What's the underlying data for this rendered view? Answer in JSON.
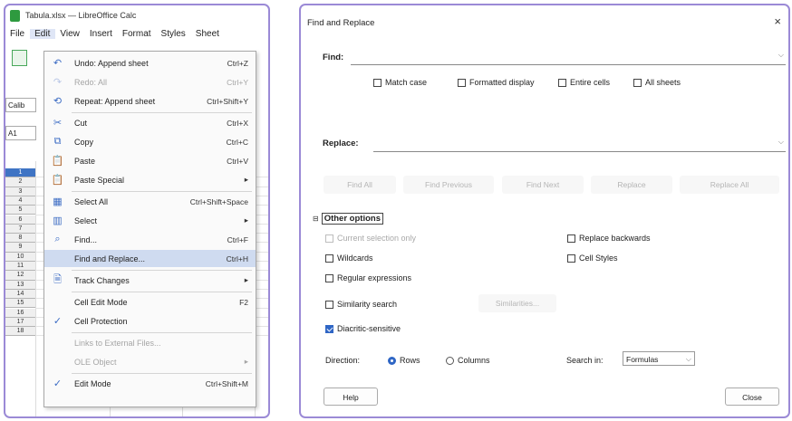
{
  "calc": {
    "window_title": "Tabula.xlsx — LibreOffice Calc",
    "menubar": [
      "File",
      "Edit",
      "View",
      "Insert",
      "Format",
      "Styles",
      "Sheet"
    ],
    "active_menu": "Edit",
    "font_name": "Calib",
    "cell_ref": "A1",
    "rows": [
      "1",
      "2",
      "3",
      "4",
      "5",
      "6",
      "7",
      "8",
      "9",
      "10",
      "11",
      "12",
      "13",
      "14",
      "15",
      "16",
      "17",
      "18"
    ],
    "selected_row": "1"
  },
  "edit_menu": {
    "items": [
      {
        "icon": "undo-icon",
        "glyph": "↶",
        "label": "Undo: Append sheet",
        "shortcut": "Ctrl+Z",
        "disabled": false
      },
      {
        "icon": "redo-icon",
        "glyph": "↷",
        "label": "Redo: All",
        "shortcut": "Ctrl+Y",
        "disabled": true
      },
      {
        "icon": "repeat-icon",
        "glyph": "⟲",
        "label": "Repeat: Append sheet",
        "shortcut": "Ctrl+Shift+Y",
        "disabled": false
      },
      {
        "icon": "cut-icon",
        "glyph": "✂",
        "label": "Cut",
        "shortcut": "Ctrl+X",
        "disabled": false
      },
      {
        "icon": "copy-icon",
        "glyph": "⧉",
        "label": "Copy",
        "shortcut": "Ctrl+C",
        "disabled": false
      },
      {
        "icon": "paste-icon",
        "glyph": "📋",
        "label": "Paste",
        "shortcut": "Ctrl+V",
        "disabled": false
      },
      {
        "icon": "paste-special-icon",
        "glyph": "📋",
        "label": "Paste Special",
        "shortcut": "▸",
        "disabled": false
      },
      {
        "icon": "select-all-icon",
        "glyph": "▦",
        "label": "Select All",
        "shortcut": "Ctrl+Shift+Space",
        "disabled": false
      },
      {
        "icon": "select-icon",
        "glyph": "▥",
        "label": "Select",
        "shortcut": "▸",
        "disabled": false
      },
      {
        "icon": "find-icon",
        "glyph": "⌕",
        "label": "Find...",
        "shortcut": "Ctrl+F",
        "disabled": false
      },
      {
        "icon": "",
        "glyph": "",
        "label": "Find and Replace...",
        "shortcut": "Ctrl+H",
        "disabled": false,
        "highlight": true
      },
      {
        "icon": "track-changes-icon",
        "glyph": "🗎",
        "label": "Track Changes",
        "shortcut": "▸",
        "disabled": false
      },
      {
        "icon": "",
        "glyph": "",
        "label": "Cell Edit Mode",
        "shortcut": "F2",
        "disabled": false
      },
      {
        "icon": "check-icon",
        "glyph": "✓",
        "label": "Cell Protection",
        "shortcut": "",
        "disabled": false
      },
      {
        "icon": "",
        "glyph": "",
        "label": "Links to External Files...",
        "shortcut": "",
        "disabled": true
      },
      {
        "icon": "",
        "glyph": "",
        "label": "OLE Object",
        "shortcut": "▸",
        "disabled": true
      },
      {
        "icon": "check-icon",
        "glyph": "✓",
        "label": "Edit Mode",
        "shortcut": "Ctrl+Shift+M",
        "disabled": false
      }
    ]
  },
  "dialog": {
    "title": "Find and Replace",
    "close_glyph": "×",
    "find_label": "Find:",
    "find_value": "",
    "find_options": [
      "Match case",
      "Formatted display",
      "Entire cells",
      "All sheets"
    ],
    "replace_label": "Replace:",
    "replace_value": "",
    "buttons": [
      "Find All",
      "Find Previous",
      "Find Next",
      "Replace",
      "Replace All"
    ],
    "other_options_label": "Other options",
    "current_selection_only": "Current selection only",
    "replace_backwards": "Replace backwards",
    "wildcards": "Wildcards",
    "cell_styles": "Cell Styles",
    "regular_expressions": "Regular expressions",
    "similarity_search": "Similarity search",
    "similarities_button": "Similarities...",
    "diacritic_sensitive": "Diacritic-sensitive",
    "direction_label": "Direction:",
    "direction_rows": "Rows",
    "direction_columns": "Columns",
    "search_in_label": "Search in:",
    "search_in_value": "Formulas",
    "help_button": "Help",
    "close_button": "Close"
  }
}
